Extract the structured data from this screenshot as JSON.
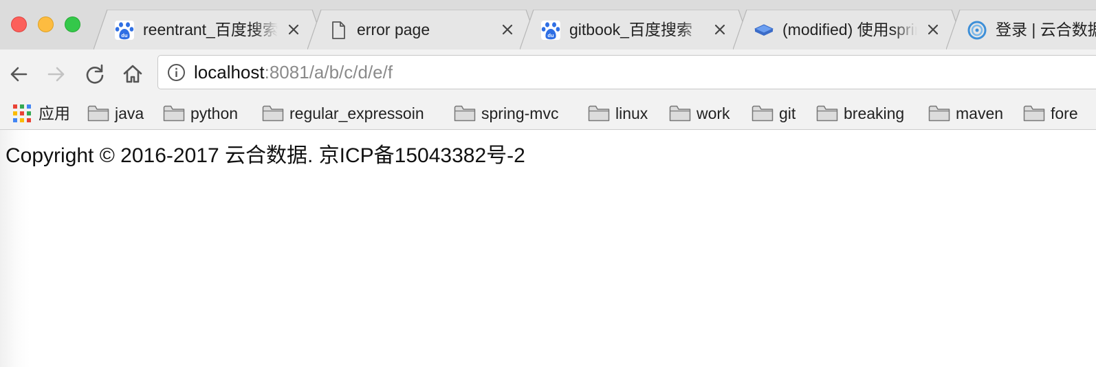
{
  "window": {
    "tabs": [
      {
        "title": "reentrant_百度搜索",
        "favicon": "baidu-paw-icon"
      },
      {
        "title": "error page",
        "favicon": "blank-page-icon"
      },
      {
        "title": "gitbook_百度搜索",
        "favicon": "baidu-paw-icon"
      },
      {
        "title": "(modified) 使用spring",
        "favicon": "book-icon"
      },
      {
        "title": "登录 | 云合数据",
        "favicon": "globe-ring-icon"
      }
    ]
  },
  "toolbar": {
    "url_host": "localhost",
    "url_rest": ":8081/a/b/c/d/e/f"
  },
  "bookmarks": {
    "apps_label": "应用",
    "folders": [
      "java",
      "python",
      "regular_expressoin",
      "spring-mvc",
      "linux",
      "work",
      "git",
      "breaking",
      "maven",
      "fore"
    ]
  },
  "page": {
    "copyright": "Copyright © 2016-2017 云合数据. 京ICP备15043382号-2"
  },
  "colors": {
    "close_light": "#fc605b",
    "minimize_light": "#fdbc40",
    "maximize_light": "#34c84a",
    "baidu_blue": "#2932e1",
    "book_blue": "#4a7fd6"
  }
}
